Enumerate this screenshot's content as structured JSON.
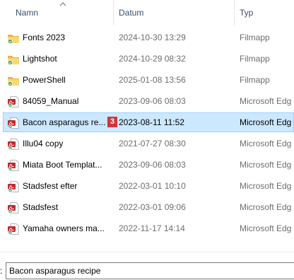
{
  "columns": {
    "name": "Namn",
    "date": "Datum",
    "type": "Typ"
  },
  "files": [
    {
      "name": "Fonts 2023",
      "date": "2024-10-30 13:29",
      "type": "Filmapp",
      "icon": "folder-icon"
    },
    {
      "name": "Lightshot",
      "date": "2024-10-29 08:32",
      "type": "Filmapp",
      "icon": "folder-icon"
    },
    {
      "name": "PowerShell",
      "date": "2025-01-08 13:56",
      "type": "Filmapp",
      "icon": "folder-icon"
    },
    {
      "name": "84059_Manual",
      "date": "2023-09-06 08:03",
      "type": "Microsoft Edg",
      "icon": "pdf-icon"
    },
    {
      "name": "Bacon asparagus re...",
      "date": "2023-08-11 11:52",
      "type": "Microsoft Edg",
      "icon": "pdf-icon",
      "selected": true,
      "badge": "3"
    },
    {
      "name": "Illu04 copy",
      "date": "2021-07-27 08:30",
      "type": "Microsoft Edg",
      "icon": "pdf-icon"
    },
    {
      "name": "Miata Boot Templat...",
      "date": "2023-09-06 08:03",
      "type": "Microsoft Edg",
      "icon": "pdf-icon"
    },
    {
      "name": "Stadsfest efter",
      "date": "2022-03-01 10:10",
      "type": "Microsoft Edg",
      "icon": "pdf-icon"
    },
    {
      "name": "Stadsfest",
      "date": "2022-03-01 09:06",
      "type": "Microsoft Edg",
      "icon": "pdf-icon"
    },
    {
      "name": "Yamaha owners ma...",
      "date": "2022-11-17 14:14",
      "type": "Microsoft Edg",
      "icon": "pdf-icon"
    }
  ],
  "filename": {
    "label_suffix": ":",
    "value": "Bacon asparagus recipe"
  },
  "colors": {
    "selection_bg": "#cce8ff",
    "selection_border": "#99d1ff",
    "badge": "#d13438",
    "folder": "#f8d775",
    "pdf": "#c4262e"
  }
}
